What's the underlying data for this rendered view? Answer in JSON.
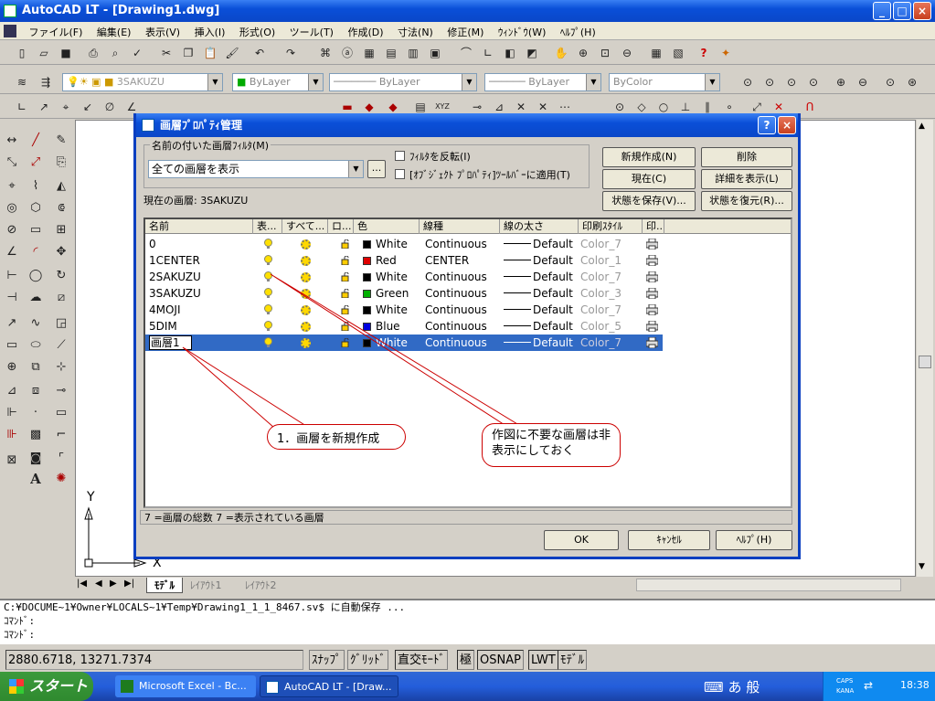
{
  "window": {
    "title": "AutoCAD LT - [Drawing1.dwg]"
  },
  "menu": [
    "ファイル(F)",
    "編集(E)",
    "表示(V)",
    "挿入(I)",
    "形式(O)",
    "ツール(T)",
    "作成(D)",
    "寸法(N)",
    "修正(M)",
    "ｳｨﾝﾄﾞｳ(W)",
    "ﾍﾙﾌﾟ(H)"
  ],
  "toolbar2": {
    "layer_combo": "3SAKUZU",
    "color_combo": "ByLayer",
    "linetype_combo": "ByLayer",
    "lineweight_combo": "ByLayer",
    "plotstyle_combo": "ByColor"
  },
  "dialog": {
    "title": "画層ﾌﾟﾛﾊﾟﾃｨ管理",
    "filter_group_label": "名前の付いた画層ﾌｨﾙﾀ(M)",
    "filter_value": "全ての画層を表示",
    "filter_browse": "...",
    "invert_filter": "ﾌｨﾙﾀを反転(I)",
    "apply_toolbar": "[ｵﾌﾞｼﾞｪｸﾄ ﾌﾟﾛﾊﾟﾃｨ]ﾂｰﾙﾊﾞｰに適用(T)",
    "buttons": {
      "new": "新規作成(N)",
      "delete": "削除",
      "current": "現在(C)",
      "details": "詳細を表示(L)",
      "save_state": "状態を保存(V)...",
      "restore_state": "状態を復元(R)..."
    },
    "current_layer_label": "現在の画層:",
    "current_layer": "3SAKUZU",
    "columns": [
      "名前",
      "表...",
      "すべて...",
      "ロ...",
      "色",
      "線種",
      "線の太さ",
      "印刷ｽﾀｲﾙ",
      "印..."
    ],
    "layers": [
      {
        "name": "0",
        "color_name": "White",
        "color_hex": "#000000",
        "linetype": "Continuous",
        "lineweight": "Default",
        "plotstyle": "Color_7"
      },
      {
        "name": "1CENTER",
        "color_name": "Red",
        "color_hex": "#e00000",
        "linetype": "CENTER",
        "lineweight": "Default",
        "plotstyle": "Color_1"
      },
      {
        "name": "2SAKUZU",
        "color_name": "White",
        "color_hex": "#000000",
        "linetype": "Continuous",
        "lineweight": "Default",
        "plotstyle": "Color_7"
      },
      {
        "name": "3SAKUZU",
        "color_name": "Green",
        "color_hex": "#00b000",
        "linetype": "Continuous",
        "lineweight": "Default",
        "plotstyle": "Color_3"
      },
      {
        "name": "4MOJI",
        "color_name": "White",
        "color_hex": "#000000",
        "linetype": "Continuous",
        "lineweight": "Default",
        "plotstyle": "Color_7"
      },
      {
        "name": "5DIM",
        "color_name": "Blue",
        "color_hex": "#0000e0",
        "linetype": "Continuous",
        "lineweight": "Default",
        "plotstyle": "Color_5"
      },
      {
        "name": "画層1",
        "color_name": "White",
        "color_hex": "#000000",
        "linetype": "Continuous",
        "lineweight": "Default",
        "plotstyle": "Color_7",
        "selected": true
      }
    ],
    "summary": "7 =画層の総数 7 =表示されている画層",
    "ok": "OK",
    "cancel": "ｷｬﾝｾﾙ",
    "help": "ﾍﾙﾌﾟ(H)"
  },
  "callouts": {
    "one": "1．画層を新規作成",
    "two": "作図に不要な画層は非表示にしておく"
  },
  "axes": {
    "y": "Y",
    "x": "X"
  },
  "layout_tabs": [
    "ﾓﾃﾞﾙ",
    "ﾚｲｱｳﾄ1",
    "ﾚｲｱｳﾄ2"
  ],
  "command_lines": [
    "C:¥DOCUME~1¥Owner¥LOCALS~1¥Temp¥Drawing1_1_1_8467.sv$ に自動保存 ...",
    "ｺﾏﾝﾄﾞ:",
    "ｺﾏﾝﾄﾞ:"
  ],
  "status": {
    "coords": "2880.6718,  13271.7374",
    "snap": "ｽﾅｯﾌﾟ",
    "grid": "ｸﾞﾘｯﾄﾞ",
    "ortho": "直交ﾓｰﾄﾞ",
    "polar": "極",
    "osnap": "OSNAP",
    "lwt": "LWT",
    "model": "ﾓﾃﾞﾙ"
  },
  "taskbar": {
    "start": "スタート",
    "task1": "Microsoft Excel - Bc...",
    "task2": "AutoCAD LT - [Draw...",
    "ime": "あ 般",
    "caps": "CAPS",
    "kana": "KANA",
    "clock": "18:38"
  }
}
